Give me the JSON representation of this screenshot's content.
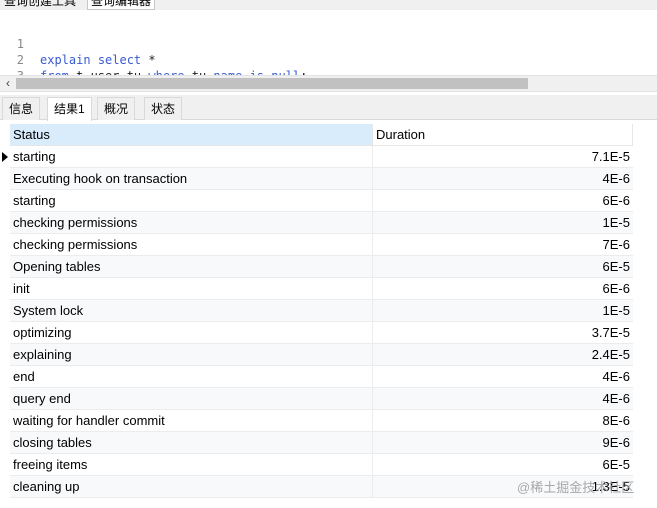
{
  "top_tabs": [
    "查询创建工具",
    "查询编辑器"
  ],
  "editor": {
    "lines": [
      {
        "num": "1",
        "tokens": [
          {
            "t": "explain",
            "kw": true
          },
          {
            "t": " "
          },
          {
            "t": "select",
            "kw": true
          },
          {
            "t": " *"
          }
        ]
      },
      {
        "num": "2",
        "tokens": [
          {
            "t": "from",
            "kw": true
          },
          {
            "t": " t_user tu "
          },
          {
            "t": "where",
            "kw": true
          },
          {
            "t": " tu."
          },
          {
            "t": "name",
            "kw": true
          },
          {
            "t": " "
          },
          {
            "t": "is",
            "kw": true
          },
          {
            "t": " "
          },
          {
            "t": "null",
            "kw": true
          },
          {
            "t": ";"
          }
        ]
      },
      {
        "num": "3",
        "tokens": []
      }
    ]
  },
  "result_tabs": [
    "信息",
    "结果1",
    "概况",
    "状态"
  ],
  "active_tab": 1,
  "grid": {
    "columns": [
      "Status",
      "Duration"
    ],
    "rows": [
      {
        "status": "starting",
        "duration": "7.1E-5"
      },
      {
        "status": "Executing hook on transaction",
        "duration": "4E-6"
      },
      {
        "status": "starting",
        "duration": "6E-6"
      },
      {
        "status": "checking permissions",
        "duration": "1E-5"
      },
      {
        "status": "checking permissions",
        "duration": "7E-6"
      },
      {
        "status": "Opening tables",
        "duration": "6E-5"
      },
      {
        "status": "init",
        "duration": "6E-6"
      },
      {
        "status": "System lock",
        "duration": "1E-5"
      },
      {
        "status": "optimizing",
        "duration": "3.7E-5"
      },
      {
        "status": "explaining",
        "duration": "2.4E-5"
      },
      {
        "status": "end",
        "duration": "4E-6"
      },
      {
        "status": "query end",
        "duration": "4E-6"
      },
      {
        "status": "waiting for handler commit",
        "duration": "8E-6"
      },
      {
        "status": "closing tables",
        "duration": "9E-6"
      },
      {
        "status": "freeing items",
        "duration": "6E-5"
      },
      {
        "status": "cleaning up",
        "duration": "1.3E-5"
      }
    ]
  },
  "watermark": "@稀土掘金技术社区",
  "colors": {
    "keyword": "#3a5bd1",
    "header_selected": "#d9ecfb"
  }
}
